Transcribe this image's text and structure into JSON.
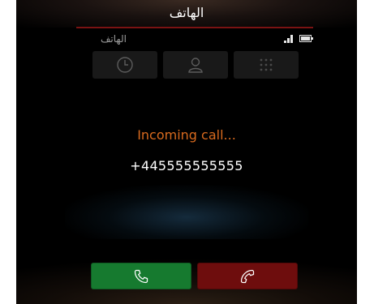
{
  "header": {
    "title": "الهاتف"
  },
  "status_bar": {
    "app_name": "الهاتف",
    "signal_icon": "signal-icon",
    "battery_icon": "battery-icon"
  },
  "tabs": [
    {
      "name": "call-log",
      "icon": "clock-icon"
    },
    {
      "name": "contacts",
      "icon": "person-icon"
    },
    {
      "name": "dialpad",
      "icon": "dialpad-icon"
    }
  ],
  "call": {
    "status": "Incoming call...",
    "number": "+445555555555"
  },
  "actions": {
    "answer": {
      "icon": "phone-answer-icon",
      "color": "#167a2f"
    },
    "reject": {
      "icon": "phone-hangup-icon",
      "color": "#6e0d0d"
    }
  },
  "colors": {
    "accent": "#d86a1e",
    "title_underline": "#7a1313"
  }
}
